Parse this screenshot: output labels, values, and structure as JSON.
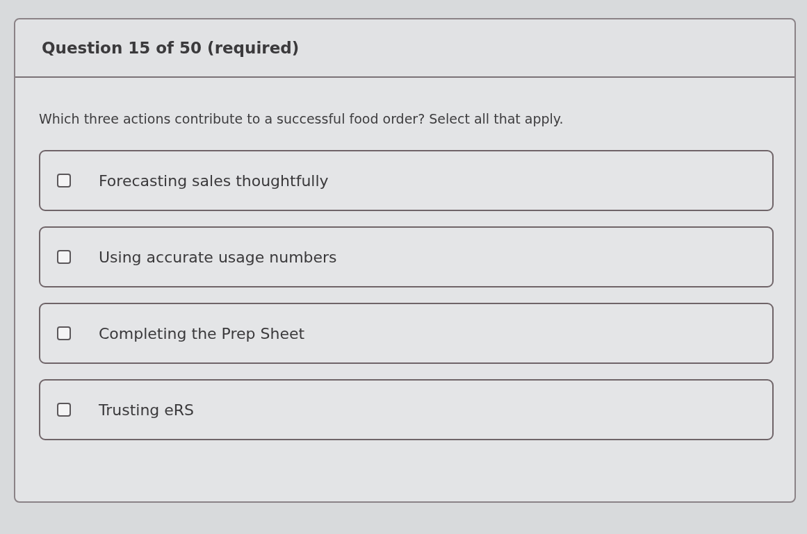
{
  "question": {
    "header": "Question 15 of 50 (required)",
    "prompt": "Which three actions contribute to a successful food order? Select all that apply.",
    "options": [
      {
        "label": "Forecasting sales thoughtfully",
        "checked": false
      },
      {
        "label": "Using accurate usage numbers",
        "checked": false
      },
      {
        "label": "Completing the Prep Sheet",
        "checked": false
      },
      {
        "label": "Trusting eRS",
        "checked": false
      }
    ]
  }
}
